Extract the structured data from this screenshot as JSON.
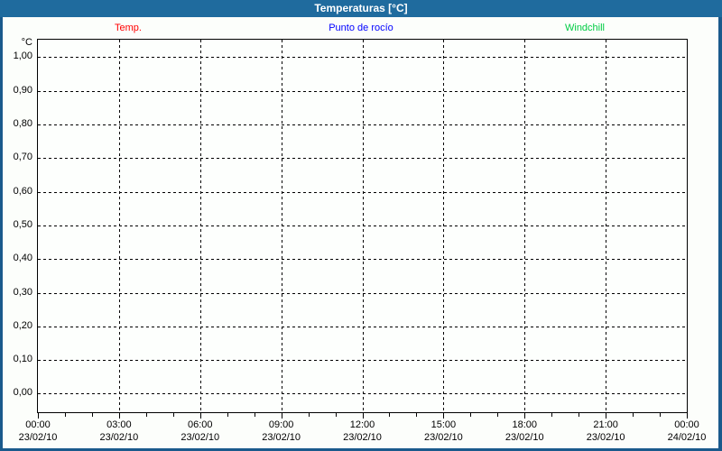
{
  "window": {
    "title": "Temperaturas [°C]"
  },
  "colors": {
    "titlebar_bg": "#1f6b9e",
    "frame_border": "#1a5a8c",
    "content_bg": "#fcfefb",
    "grid": "#000000",
    "temp_series": "#ff0000",
    "dew_point_series": "#0000ff",
    "windchill_series": "#00cc44"
  },
  "chart_data": {
    "type": "line",
    "title": "Temperaturas [°C]",
    "xlabel": "",
    "ylabel": "°C",
    "ylim": [
      -0.055,
      1.052
    ],
    "grid": true,
    "legend_position": "top",
    "y_ticks": [
      {
        "value": 1.0,
        "label": "1,00"
      },
      {
        "value": 0.9,
        "label": "0,90"
      },
      {
        "value": 0.8,
        "label": "0,80"
      },
      {
        "value": 0.7,
        "label": "0,70"
      },
      {
        "value": 0.6,
        "label": "0,60"
      },
      {
        "value": 0.5,
        "label": "0,50"
      },
      {
        "value": 0.4,
        "label": "0,40"
      },
      {
        "value": 0.3,
        "label": "0,30"
      },
      {
        "value": 0.2,
        "label": "0,20"
      },
      {
        "value": 0.1,
        "label": "0,10"
      },
      {
        "value": 0.0,
        "label": "0,00"
      }
    ],
    "x_ticks": [
      {
        "time": "00:00",
        "date": "23/02/10"
      },
      {
        "time": "03:00",
        "date": "23/02/10"
      },
      {
        "time": "06:00",
        "date": "23/02/10"
      },
      {
        "time": "09:00",
        "date": "23/02/10"
      },
      {
        "time": "12:00",
        "date": "23/02/10"
      },
      {
        "time": "15:00",
        "date": "23/02/10"
      },
      {
        "time": "18:00",
        "date": "23/02/10"
      },
      {
        "time": "21:00",
        "date": "23/02/10"
      },
      {
        "time": "00:00",
        "date": "24/02/10"
      }
    ],
    "minor_x_ticks_per_interval": 3,
    "series": [
      {
        "name": "Temp.",
        "color": "#ff0000",
        "values": []
      },
      {
        "name": "Punto de rocío",
        "color": "#0000ff",
        "values": []
      },
      {
        "name": "Windchill",
        "color": "#00cc44",
        "values": []
      }
    ]
  }
}
